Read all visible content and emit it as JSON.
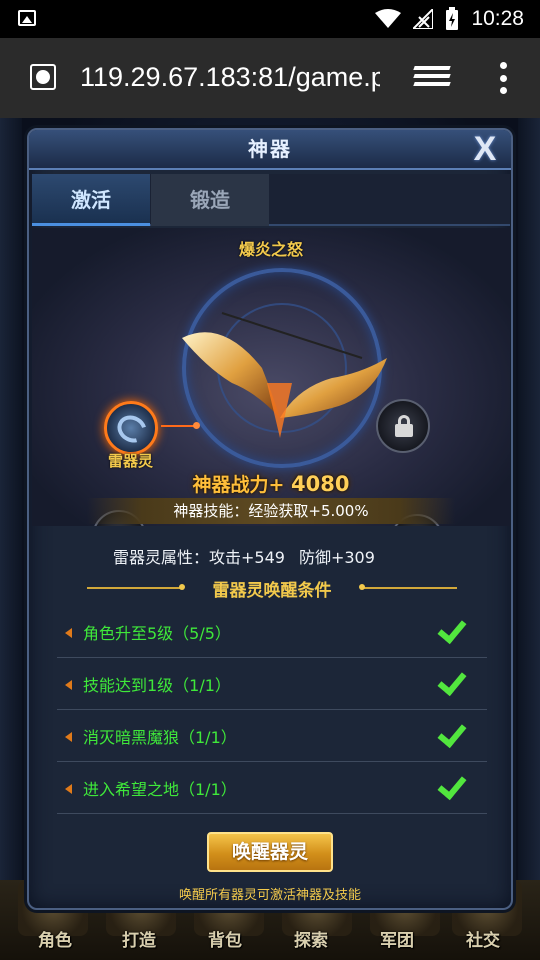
{
  "status_bar": {
    "time": "10:28",
    "icons": [
      "image-icon",
      "wifi-icon",
      "signal-icon",
      "battery-icon"
    ]
  },
  "browser": {
    "url": "119.29.67.183:81/game.p",
    "icons": [
      "site-globe-icon",
      "tabs-icon",
      "overflow-menu-icon"
    ]
  },
  "modal": {
    "title": "神器",
    "close_label": "X",
    "tabs": [
      {
        "label": "激活",
        "active": true
      },
      {
        "label": "锻造",
        "active": false
      }
    ],
    "artifact": {
      "name": "爆炎之怒",
      "active_spirit_label": "雷器灵",
      "power_label": "神器战力+",
      "power_value": "4080",
      "skill_text": "神器技能：经验获取+5.00%"
    },
    "attributes": {
      "label": "雷器灵属性：",
      "attack": "攻击+549",
      "defense": "防御+309"
    },
    "conditions_title": "雷器灵唤醒条件",
    "conditions": [
      {
        "text": "角色升至5级（5/5）",
        "done": true
      },
      {
        "text": "技能达到1级（1/1）",
        "done": true
      },
      {
        "text": "消灭暗黑魔狼（1/1）",
        "done": true
      },
      {
        "text": "进入希望之地（1/1）",
        "done": true
      }
    ],
    "awaken_button": "唤醒器灵",
    "hint": "唤醒所有器灵可激活神器及技能"
  },
  "bottom_nav": [
    "角色",
    "打造",
    "背包",
    "探索",
    "军团",
    "社交"
  ],
  "colors": {
    "gold": "#f2c94c",
    "green": "#3fe83a",
    "accent_blue": "#4b8fe0",
    "panel": "#1c2638"
  }
}
